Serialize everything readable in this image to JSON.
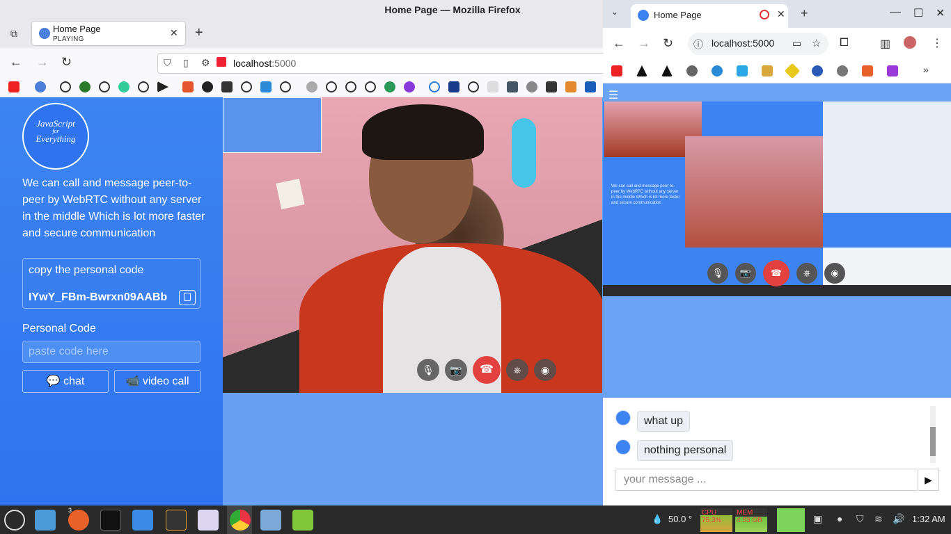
{
  "firefox": {
    "window_title": "Home Page — Mozilla Firefox",
    "tab": {
      "title": "Home Page",
      "subtitle": "PLAYING",
      "close": "✕"
    },
    "new_tab": "+",
    "url_host": "localhost",
    "url_port": ":5000"
  },
  "app": {
    "logo_line1": "JavaScript",
    "logo_line2": "for",
    "logo_line3": "Everything",
    "intro": "We can call and message peer-to-peer by WebRTC without any server in the middle Which is lot more faster and secure communication",
    "copy_label": "copy the personal code",
    "personal_code_value": "IYwY_FBm-Bwrxn09AABb",
    "personal_code_label": "Personal Code",
    "paste_placeholder": "paste code here",
    "chat_button": "chat",
    "video_button": "video call"
  },
  "chrome": {
    "tab_title": "Home Page",
    "url": "localhost:5000",
    "shot_text": "We can call and message peer-to-peer by WebRTC without any server in the middle Which is lot more faster and secure communication"
  },
  "chat": {
    "messages": [
      "what up",
      "nothing personal"
    ],
    "input_placeholder": "your message ...",
    "send_icon": "▶"
  },
  "taskbar": {
    "firefox_badge": "3",
    "temperature": "50.0 °",
    "cpu_label": "CPU",
    "cpu_value": "75.3%",
    "mem_label": "MEM",
    "mem_value": "4.53 GB",
    "clock": "1:32 AM"
  },
  "colors": {
    "sidebar_blue": "#2f73ee",
    "page_blue": "#68a1f4",
    "hangup_red": "#e34040"
  }
}
